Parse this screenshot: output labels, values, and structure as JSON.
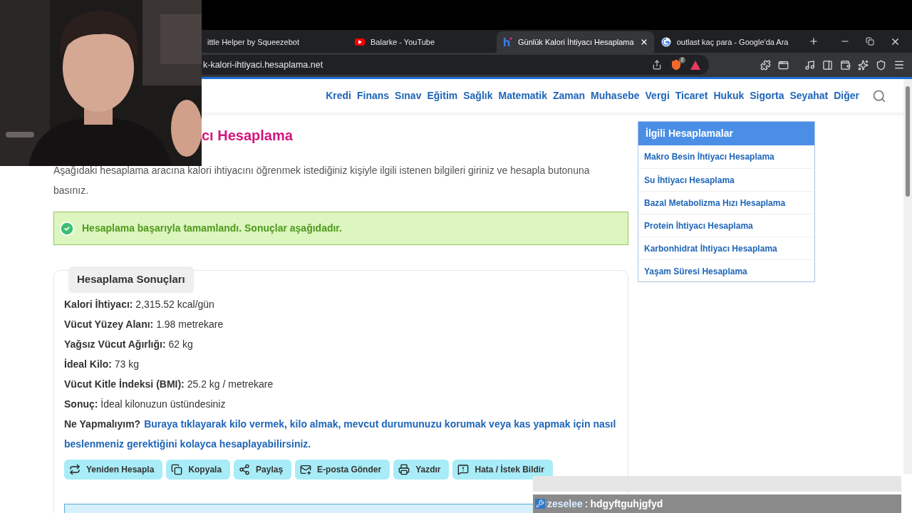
{
  "browser": {
    "tabs": [
      {
        "title": "ittle Helper by Squeezebot",
        "kind": "plain",
        "selected": false
      },
      {
        "title": "Balarke - YouTube",
        "kind": "video",
        "selected": false
      },
      {
        "title": "Günlük Kalori İhtiyacı Hesaplama",
        "kind": "site",
        "selected": true
      },
      {
        "title": "outlast kaç para - Google'da Ara",
        "kind": "search",
        "selected": false
      }
    ],
    "address": "k-kalori-ihtiyaci.hesaplama.net",
    "shield_badge": "2"
  },
  "nav": [
    "Kredi",
    "Finans",
    "Sınav",
    "Eğitim",
    "Sağlık",
    "Matematik",
    "Zaman",
    "Muhasebe",
    "Vergi",
    "Ticaret",
    "Hukuk",
    "Sigorta",
    "Seyahat",
    "Diğer"
  ],
  "title": "cı Hesaplama",
  "intro": "Aşağıdaki hesaplama aracına kalori ihtiyacını öğrenmek istediğiniz kişiyle ilgili istenen bilgileri giriniz ve hesapla butonuna basınız.",
  "alert": "Hesaplama başarıyla tamamlandı. Sonuçlar aşağıdadır.",
  "results": {
    "heading": "Hesaplama Sonuçları",
    "rows": [
      {
        "label": "Kalori İhtiyacı:",
        "value": "2,315.52 kcal/gün"
      },
      {
        "label": "Vücut Yüzey Alanı:",
        "value": "1.98 metrekare"
      },
      {
        "label": "Yağsız Vücut Ağırlığı:",
        "value": "62 kg"
      },
      {
        "label": "İdeal Kilo:",
        "value": "73 kg"
      },
      {
        "label": "Vücut Kitle İndeksi (BMI):",
        "value": "25.2 kg / metrekare"
      },
      {
        "label": "Sonuç:",
        "value": "İdeal kilonuzun üstündesiniz"
      }
    ],
    "advice_label": "Ne Yapmalıyım?",
    "advice_link": "Buraya tıklayarak kilo vermek, kilo almak, mevcut durumunuzu korumak veya kas yapmak için nasıl beslenmeniz gerektiğini kolayca hesaplayabilirsiniz."
  },
  "actions": [
    {
      "label": "Yeniden Hesapla",
      "kind": "recalc"
    },
    {
      "label": "Kopyala",
      "kind": "copy"
    },
    {
      "label": "Paylaş",
      "kind": "share"
    },
    {
      "label": "E-posta Gönder",
      "kind": "mail"
    },
    {
      "label": "Yazdır",
      "kind": "print"
    },
    {
      "label": "Hata / İstek Bildir",
      "kind": "report"
    }
  ],
  "sidebar": {
    "heading": "İlgili Hesaplamalar",
    "items": [
      "Makro Besin İhtiyacı Hesaplama",
      "Su İhtiyacı Hesaplama",
      "Bazal Metabolizma Hızı Hesaplama",
      "Protein İhtiyacı Hesaplama",
      "Karbonhidrat İhtiyacı Hesaplama",
      "Yaşam Süresi Hesaplama"
    ]
  },
  "chat": {
    "user": "zeselee",
    "separator": ":",
    "message": "hdgyftguhjgfyd"
  }
}
